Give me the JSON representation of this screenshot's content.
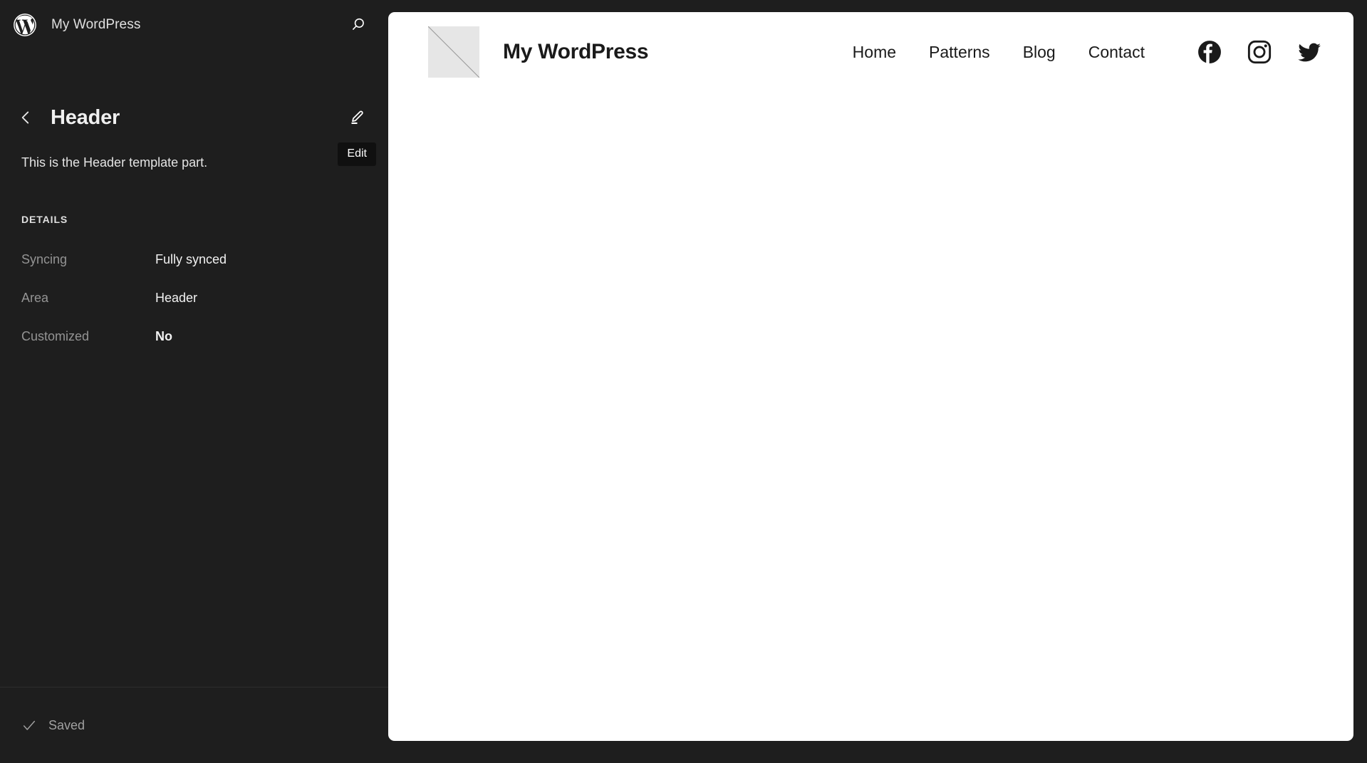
{
  "sidebar": {
    "logo_icon": "wordpress-logo",
    "site_name": "My WordPress",
    "search_icon": "search-icon",
    "back_icon": "chevron-left-icon",
    "panel_title": "Header",
    "edit_icon": "pencil-icon",
    "edit_tooltip": "Edit",
    "description": "This is the Header template part.",
    "details_heading": "DETAILS",
    "details": [
      {
        "key": "Syncing",
        "value": "Fully synced",
        "strong": false
      },
      {
        "key": "Area",
        "value": "Header",
        "strong": false
      },
      {
        "key": "Customized",
        "value": "No",
        "strong": true
      }
    ],
    "footer": {
      "check_icon": "checkmark-icon",
      "status": "Saved"
    },
    "background": "#1e1e1e"
  },
  "canvas": {
    "logo_placeholder_icon": "broken-image-placeholder",
    "site_title": "My WordPress",
    "nav": [
      {
        "label": "Home"
      },
      {
        "label": "Patterns"
      },
      {
        "label": "Blog"
      },
      {
        "label": "Contact"
      }
    ],
    "social": [
      {
        "name": "facebook-icon",
        "label": "Facebook"
      },
      {
        "name": "instagram-icon",
        "label": "Instagram"
      },
      {
        "name": "twitter-icon",
        "label": "Twitter"
      }
    ],
    "background": "#ffffff"
  }
}
